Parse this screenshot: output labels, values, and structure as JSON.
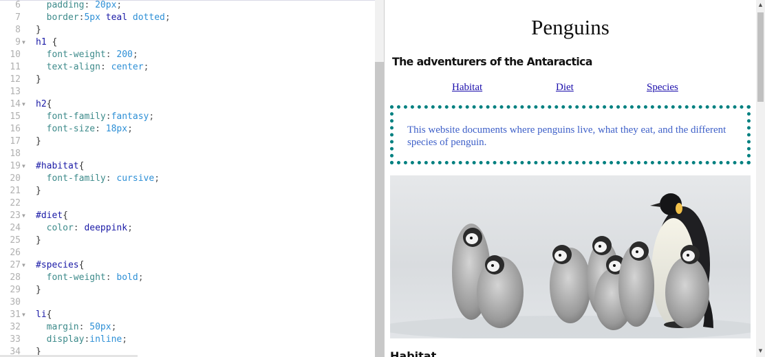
{
  "editor": {
    "lines": [
      {
        "num": "6",
        "fold": "",
        "tokens": [
          {
            "t": "  ",
            "c": ""
          },
          {
            "t": "padding",
            "c": "prop"
          },
          {
            "t": ": ",
            "c": "punc"
          },
          {
            "t": "20px",
            "c": "val"
          },
          {
            "t": ";",
            "c": "punc"
          }
        ]
      },
      {
        "num": "7",
        "fold": "",
        "tokens": [
          {
            "t": "  ",
            "c": ""
          },
          {
            "t": "border",
            "c": "prop"
          },
          {
            "t": ":",
            "c": "punc"
          },
          {
            "t": "5px",
            "c": "val"
          },
          {
            "t": " ",
            "c": ""
          },
          {
            "t": "teal",
            "c": "sel"
          },
          {
            "t": " ",
            "c": ""
          },
          {
            "t": "dotted",
            "c": "val"
          },
          {
            "t": ";",
            "c": "punc"
          }
        ]
      },
      {
        "num": "8",
        "fold": "",
        "tokens": [
          {
            "t": "}",
            "c": "brace"
          }
        ]
      },
      {
        "num": "9",
        "fold": "▼",
        "tokens": [
          {
            "t": "h1",
            "c": "sel"
          },
          {
            "t": " {",
            "c": "brace"
          }
        ]
      },
      {
        "num": "10",
        "fold": "",
        "tokens": [
          {
            "t": "  ",
            "c": ""
          },
          {
            "t": "font-weight",
            "c": "prop"
          },
          {
            "t": ": ",
            "c": "punc"
          },
          {
            "t": "200",
            "c": "val"
          },
          {
            "t": ";",
            "c": "punc"
          }
        ]
      },
      {
        "num": "11",
        "fold": "",
        "tokens": [
          {
            "t": "  ",
            "c": ""
          },
          {
            "t": "text-align",
            "c": "prop"
          },
          {
            "t": ": ",
            "c": "punc"
          },
          {
            "t": "center",
            "c": "val"
          },
          {
            "t": ";",
            "c": "punc"
          }
        ]
      },
      {
        "num": "12",
        "fold": "",
        "tokens": [
          {
            "t": "}",
            "c": "brace"
          }
        ]
      },
      {
        "num": "13",
        "fold": "",
        "tokens": []
      },
      {
        "num": "14",
        "fold": "▼",
        "tokens": [
          {
            "t": "h2",
            "c": "sel"
          },
          {
            "t": "{",
            "c": "brace"
          }
        ]
      },
      {
        "num": "15",
        "fold": "",
        "tokens": [
          {
            "t": "  ",
            "c": ""
          },
          {
            "t": "font-family",
            "c": "prop"
          },
          {
            "t": ":",
            "c": "punc"
          },
          {
            "t": "fantasy",
            "c": "val"
          },
          {
            "t": ";",
            "c": "punc"
          }
        ]
      },
      {
        "num": "16",
        "fold": "",
        "tokens": [
          {
            "t": "  ",
            "c": ""
          },
          {
            "t": "font-size",
            "c": "prop"
          },
          {
            "t": ": ",
            "c": "punc"
          },
          {
            "t": "18px",
            "c": "val"
          },
          {
            "t": ";",
            "c": "punc"
          }
        ]
      },
      {
        "num": "17",
        "fold": "",
        "tokens": [
          {
            "t": "}",
            "c": "brace"
          }
        ]
      },
      {
        "num": "18",
        "fold": "",
        "tokens": []
      },
      {
        "num": "19",
        "fold": "▼",
        "tokens": [
          {
            "t": "#habitat",
            "c": "sel"
          },
          {
            "t": "{",
            "c": "brace"
          }
        ]
      },
      {
        "num": "20",
        "fold": "",
        "tokens": [
          {
            "t": "  ",
            "c": ""
          },
          {
            "t": "font-family",
            "c": "prop"
          },
          {
            "t": ": ",
            "c": "punc"
          },
          {
            "t": "cursive",
            "c": "val"
          },
          {
            "t": ";",
            "c": "punc"
          }
        ]
      },
      {
        "num": "21",
        "fold": "",
        "tokens": [
          {
            "t": "}",
            "c": "brace"
          }
        ]
      },
      {
        "num": "22",
        "fold": "",
        "tokens": []
      },
      {
        "num": "23",
        "fold": "▼",
        "tokens": [
          {
            "t": "#diet",
            "c": "sel"
          },
          {
            "t": "{",
            "c": "brace"
          }
        ]
      },
      {
        "num": "24",
        "fold": "",
        "tokens": [
          {
            "t": "  ",
            "c": ""
          },
          {
            "t": "color",
            "c": "prop"
          },
          {
            "t": ": ",
            "c": "punc"
          },
          {
            "t": "deeppink",
            "c": "sel"
          },
          {
            "t": ";",
            "c": "punc"
          }
        ]
      },
      {
        "num": "25",
        "fold": "",
        "tokens": [
          {
            "t": "}",
            "c": "brace"
          }
        ]
      },
      {
        "num": "26",
        "fold": "",
        "tokens": []
      },
      {
        "num": "27",
        "fold": "▼",
        "tokens": [
          {
            "t": "#species",
            "c": "sel"
          },
          {
            "t": "{",
            "c": "brace"
          }
        ]
      },
      {
        "num": "28",
        "fold": "",
        "tokens": [
          {
            "t": "  ",
            "c": ""
          },
          {
            "t": "font-weight",
            "c": "prop"
          },
          {
            "t": ": ",
            "c": "punc"
          },
          {
            "t": "bold",
            "c": "val"
          },
          {
            "t": ";",
            "c": "punc"
          }
        ]
      },
      {
        "num": "29",
        "fold": "",
        "tokens": [
          {
            "t": "}",
            "c": "brace"
          }
        ]
      },
      {
        "num": "30",
        "fold": "",
        "tokens": []
      },
      {
        "num": "31",
        "fold": "▼",
        "tokens": [
          {
            "t": "li",
            "c": "sel"
          },
          {
            "t": "{",
            "c": "brace"
          }
        ]
      },
      {
        "num": "32",
        "fold": "",
        "tokens": [
          {
            "t": "  ",
            "c": ""
          },
          {
            "t": "margin",
            "c": "prop"
          },
          {
            "t": ": ",
            "c": "punc"
          },
          {
            "t": "50px",
            "c": "val"
          },
          {
            "t": ";",
            "c": "punc"
          }
        ]
      },
      {
        "num": "33",
        "fold": "",
        "tokens": [
          {
            "t": "  ",
            "c": ""
          },
          {
            "t": "display",
            "c": "prop"
          },
          {
            "t": ":",
            "c": "punc"
          },
          {
            "t": "inline",
            "c": "val"
          },
          {
            "t": ";",
            "c": "punc"
          }
        ]
      },
      {
        "num": "34",
        "fold": "",
        "tokens": [
          {
            "t": "}",
            "c": "brace"
          }
        ]
      }
    ]
  },
  "preview": {
    "title": "Penguins",
    "subtitle": "The adventurers of the Antaractica",
    "nav": {
      "habitat": "Habitat",
      "diet": "Diet",
      "species": "Species"
    },
    "intro": "This website documents where penguins live, what they eat, and the different species of penguin.",
    "next_heading": "Habitat",
    "box_border_color": "#008080",
    "link_color": "#1a0dab",
    "intro_color": "#3d5fc8"
  }
}
